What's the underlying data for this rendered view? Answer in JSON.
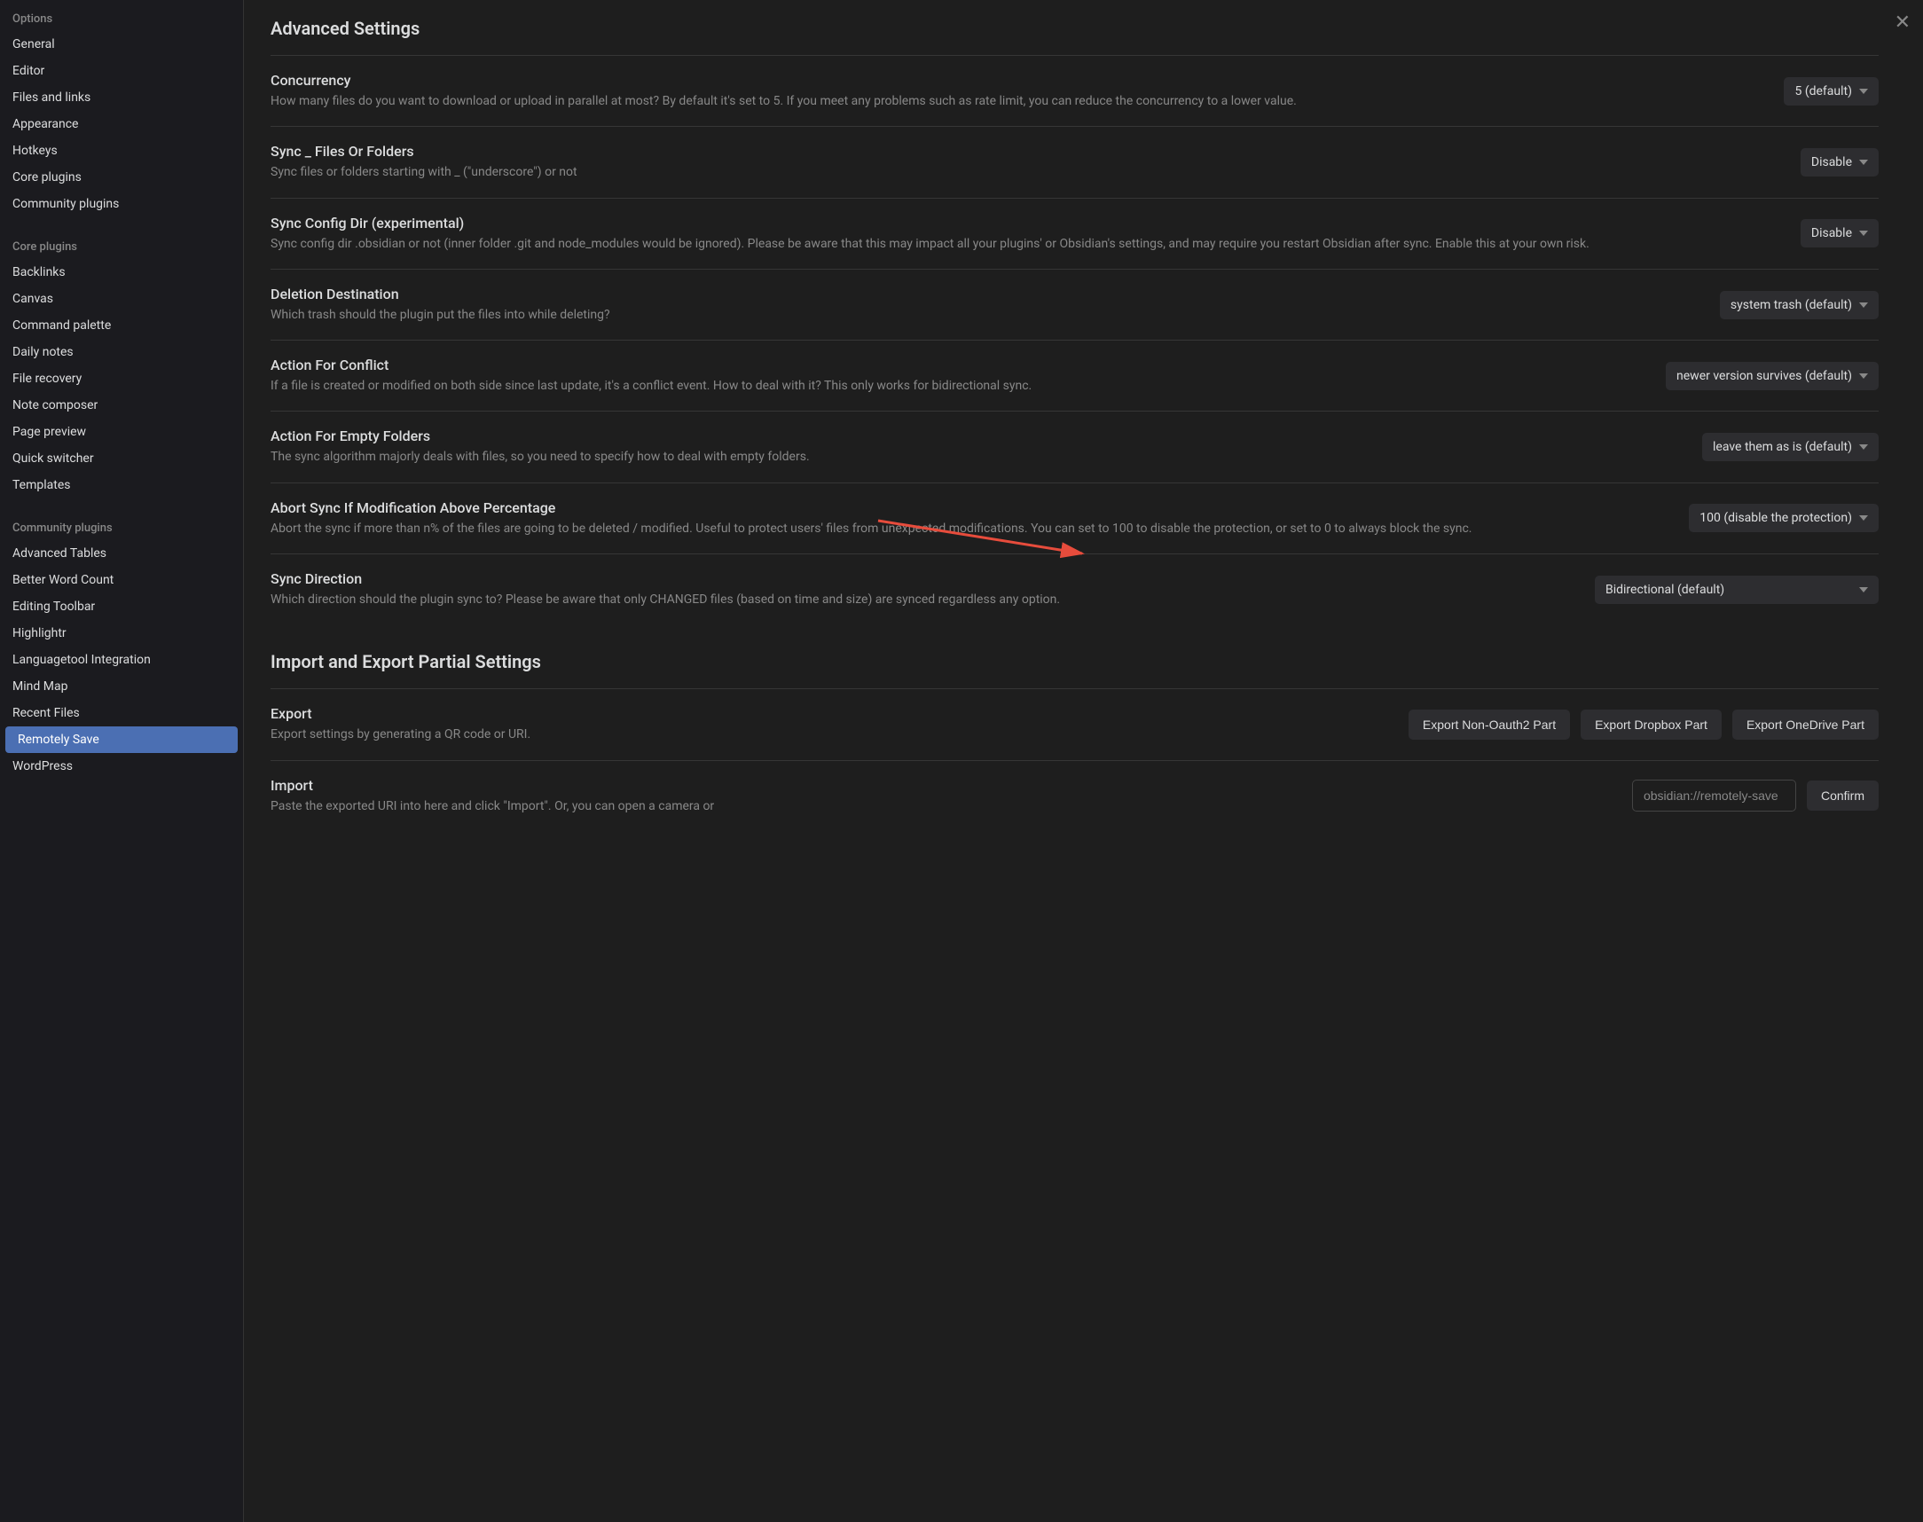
{
  "sidebar": {
    "options_heading": "Options",
    "options_items": [
      "General",
      "Editor",
      "Files and links",
      "Appearance",
      "Hotkeys",
      "Core plugins",
      "Community plugins"
    ],
    "core_heading": "Core plugins",
    "core_items": [
      "Backlinks",
      "Canvas",
      "Command palette",
      "Daily notes",
      "File recovery",
      "Note composer",
      "Page preview",
      "Quick switcher",
      "Templates"
    ],
    "community_heading": "Community plugins",
    "community_items": [
      "Advanced Tables",
      "Better Word Count",
      "Editing Toolbar",
      "Highlightr",
      "Languagetool Integration",
      "Mind Map",
      "Recent Files",
      "Remotely Save",
      "WordPress"
    ],
    "active": "Remotely Save"
  },
  "main": {
    "title": "Advanced Settings",
    "settings": [
      {
        "title": "Concurrency",
        "desc": "How many files do you want to download or upload in parallel at most? By default it's set to 5. If you meet any problems such as rate limit, you can reduce the concurrency to a lower value.",
        "value": "5 (default)"
      },
      {
        "title": "Sync _ Files Or Folders",
        "desc": "Sync files or folders starting with _ (\"underscore\") or not",
        "value": "Disable"
      },
      {
        "title": "Sync Config Dir (experimental)",
        "desc": "Sync config dir .obsidian or not (inner folder .git and node_modules would be ignored). Please be aware that this may impact all your plugins' or Obsidian's settings, and may require you restart Obsidian after sync. Enable this at your own risk.",
        "value": "Disable"
      },
      {
        "title": "Deletion Destination",
        "desc": "Which trash should the plugin put the files into while deleting?",
        "value": "system trash (default)"
      },
      {
        "title": "Action For Conflict",
        "desc": "If a file is created or modified on both side since last update, it's a conflict event. How to deal with it? This only works for bidirectional sync.",
        "value": "newer version survives (default)"
      },
      {
        "title": "Action For Empty Folders",
        "desc": "The sync algorithm majorly deals with files, so you need to specify how to deal with empty folders.",
        "value": "leave them as is (default)"
      },
      {
        "title": "Abort Sync If Modification Above Percentage",
        "desc": "Abort the sync if more than n% of the files are going to be deleted / modified. Useful to protect users' files from unexpected modifications. You can set to 100 to disable the protection, or set to 0 to always block the sync.",
        "value": "100 (disable the protection)"
      },
      {
        "title": "Sync Direction",
        "desc": "Which direction should the plugin sync to? Please be aware that only CHANGED files (based on time and size) are synced regardless any option.",
        "value": "Bidirectional (default)",
        "wide": true
      }
    ],
    "import_export_title": "Import and Export Partial Settings",
    "export": {
      "title": "Export",
      "desc": "Export settings by generating a QR code or URI.",
      "buttons": [
        "Export Non-Oauth2 Part",
        "Export Dropbox Part",
        "Export OneDrive Part"
      ]
    },
    "import": {
      "title": "Import",
      "desc": "Paste the exported URI into here and click \"Import\". Or, you can open a camera or",
      "placeholder": "obsidian://remotely-save",
      "confirm": "Confirm"
    }
  }
}
